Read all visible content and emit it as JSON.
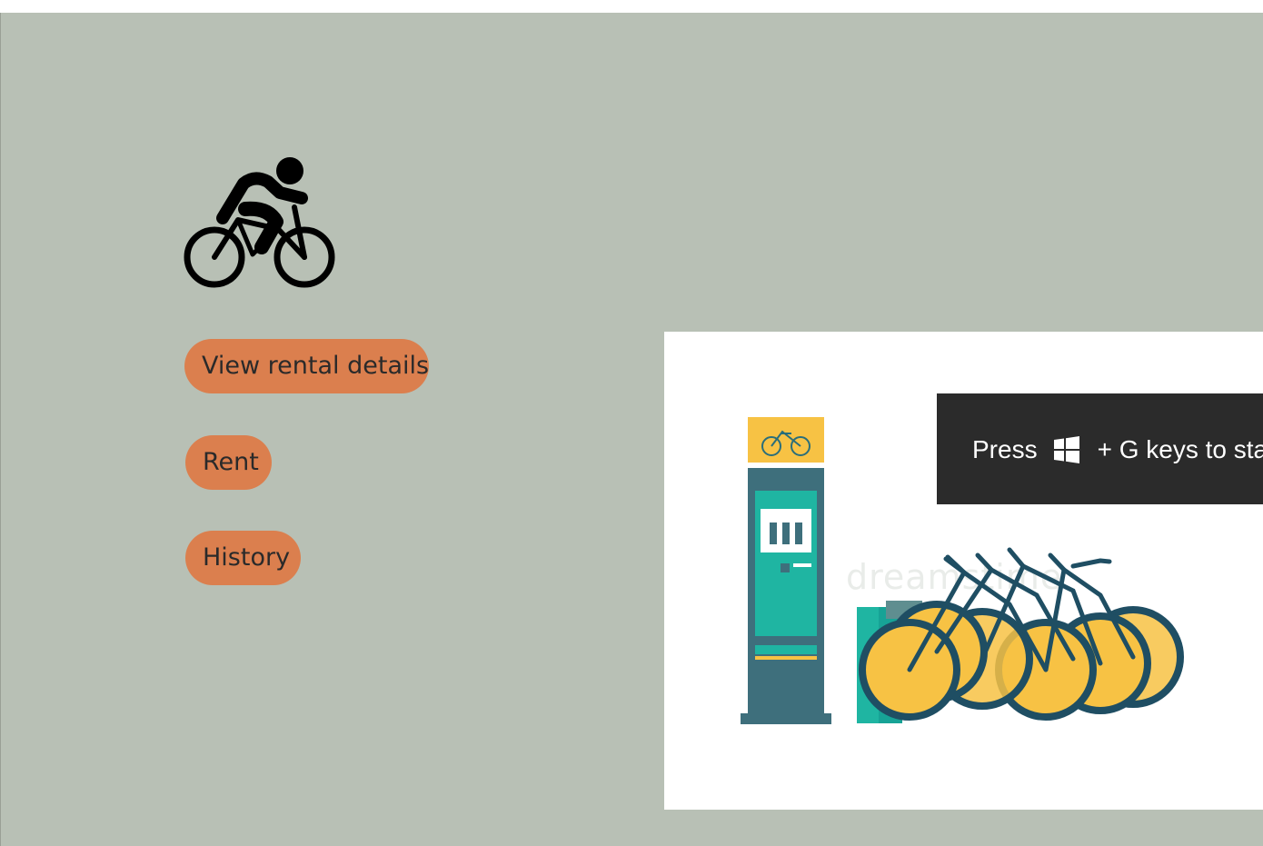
{
  "app": {
    "actions": [
      {
        "label": "View rental details"
      },
      {
        "label": "Rent"
      },
      {
        "label": "History"
      }
    ],
    "accent_color": "#db7f4e",
    "background_color": "#b8c0b5"
  },
  "illustration": {
    "watermark": "dreamstime"
  },
  "toast": {
    "prefix": "Press",
    "suffix": "+ G keys to sta",
    "key_icon": "windows-logo-icon"
  }
}
